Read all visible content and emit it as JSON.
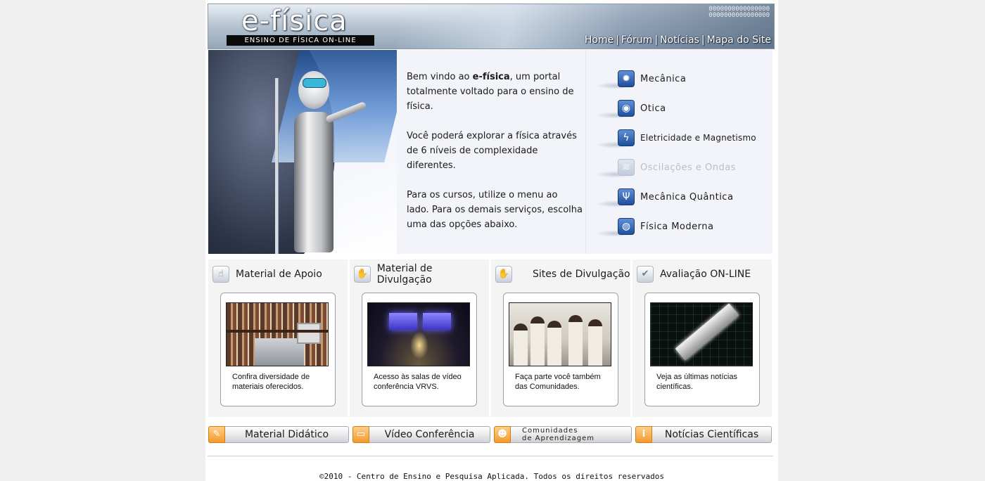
{
  "header": {
    "logo": "e-física",
    "subtitle": "ENSINO DE FÍSICA ON-LINE",
    "digits": "0000000000000000\n0000000000000000",
    "nav": [
      {
        "label": "Home"
      },
      {
        "label": "Fórum"
      },
      {
        "label": "Notícias"
      },
      {
        "label": "Mapa do Site"
      }
    ],
    "nav_separator": "|"
  },
  "hero": {
    "intro_before": "Bem vindo ao ",
    "intro_brand": "e-física",
    "intro_after": ", um portal totalmente voltado para o ensino de física.",
    "paragraph2": "Você poderá explorar a física através de 6 níveis de complexidade  diferentes.",
    "paragraph3": "Para os cursos, utilize o menu ao lado. Para os demais serviços, escolha uma das opções abaixo."
  },
  "courses": [
    {
      "label": "Mecânica",
      "icon": "gear-icon",
      "glyph": "✹",
      "enabled": true
    },
    {
      "label": "Otica",
      "icon": "eye-icon",
      "glyph": "◉",
      "enabled": true
    },
    {
      "label": "Eletricidade e Magnetismo",
      "icon": "lightning-icon",
      "glyph": "ϟ",
      "enabled": true
    },
    {
      "label": "Oscilações e Ondas",
      "icon": "wave-icon",
      "glyph": "≋",
      "enabled": false
    },
    {
      "label": "Mecânica Quântica",
      "icon": "psi-icon",
      "glyph": "Ψ",
      "enabled": true
    },
    {
      "label": "Física Moderna",
      "icon": "globe-icon",
      "glyph": "◍",
      "enabled": true
    }
  ],
  "sections": [
    {
      "title": "Material de Apoio",
      "icon": "hand-pointer-icon",
      "glyph": "☝",
      "description": "Confira diversidade de materiais oferecidos."
    },
    {
      "title": "Material de Divulgação",
      "icon": "handshake-icon",
      "glyph": "✋",
      "description": "Acesso às salas de vídeo conferência VRVS."
    },
    {
      "title": "Sites de Divulgação",
      "icon": "handshake-icon",
      "glyph": "✋",
      "description": "Faça parte você também das Comunidades."
    },
    {
      "title": "Avaliação ON-LINE",
      "icon": "checkmark-icon",
      "glyph": "✔",
      "description": "Veja as últimas notícias científicas."
    }
  ],
  "bottom_buttons": [
    {
      "label": "Material Didático",
      "icon": "pencil-icon",
      "glyph": "✎"
    },
    {
      "label": "Vídeo Conferência",
      "icon": "video-icon",
      "glyph": "▭"
    },
    {
      "label_line1": "Comunidades",
      "label_line2": "de Aprendizagem",
      "icon": "people-icon",
      "glyph": "☻"
    },
    {
      "label": "Notícias Científicas",
      "icon": "info-icon",
      "glyph": "i"
    }
  ],
  "footer": {
    "text": "©2010 - Centro de Ensino e Pesquisa Aplicada. Todos os direitos reservados"
  },
  "colors": {
    "page_background": "#efefef",
    "hero_background": "#f2f4fa",
    "course_icon": "#1f4f9b",
    "bottom_icon": "#f39a2c"
  }
}
